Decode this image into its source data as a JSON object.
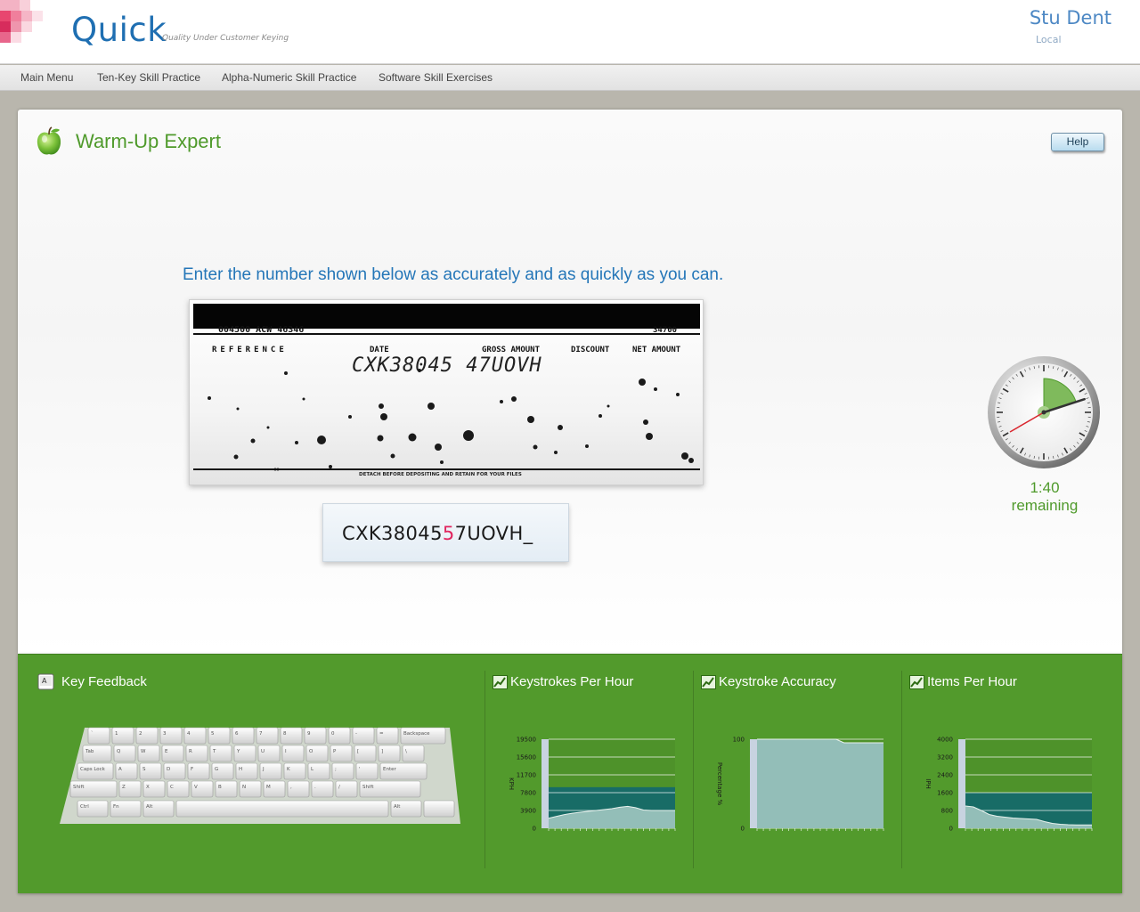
{
  "header": {
    "brand": "Quick",
    "tagline": "Quality Under Customer Keying",
    "user_name": "Stu Dent",
    "user_location": "Local"
  },
  "nav": {
    "items": [
      {
        "label": "Main Menu"
      },
      {
        "label": "Ten-Key Skill Practice"
      },
      {
        "label": "Alpha-Numeric Skill Practice"
      },
      {
        "label": "Software Skill Exercises"
      }
    ]
  },
  "exercise": {
    "title": "Warm-Up Expert",
    "help_label": "Help",
    "instruction": "Enter the number shown below as accurately and as quickly as you can.",
    "document": {
      "account_line": "004500  ACW 46346",
      "amount_corner": "34700",
      "columns": [
        "REFERENCE",
        "DATE",
        "GROSS AMOUNT",
        "DISCOUNT",
        "NET AMOUNT"
      ],
      "handwritten_value": "CXK38045 47UOVH",
      "footer_text": "DETACH BEFORE DEPOSITING AND RETAIN FOR YOUR FILES"
    },
    "entry": {
      "before_error": "CXK38045",
      "error_char": "5",
      "after_error": "7UOVH_"
    },
    "timer": {
      "remaining_label": "1:40 remaining",
      "elapsed_fraction": 0.2
    }
  },
  "stats": {
    "key_feedback": {
      "title": "Key Feedback"
    },
    "keyboard_keys": {
      "backspace": "Backspace",
      "tab": "Tab",
      "caps": "Caps Lock",
      "shift_left": "Shift",
      "shift_right": "Shift",
      "enter": "Enter",
      "ctrl": "Ctrl",
      "fn": "Fn",
      "alt_left": "Alt",
      "alt_right": "Alt",
      "row_top": [
        "`",
        "1",
        "2",
        "3",
        "4",
        "5",
        "6",
        "7",
        "8",
        "9",
        "0",
        "-",
        "="
      ],
      "row_q": [
        "Q",
        "W",
        "E",
        "R",
        "T",
        "Y",
        "U",
        "I",
        "O",
        "P",
        "[",
        "]",
        "\\"
      ],
      "row_a": [
        "A",
        "S",
        "D",
        "F",
        "G",
        "H",
        "J",
        "K",
        "L",
        ";",
        "'"
      ],
      "row_z": [
        "Z",
        "X",
        "C",
        "V",
        "B",
        "N",
        "M",
        ",",
        ".",
        "/"
      ]
    },
    "charts": [
      {
        "title": "Keystrokes Per Hour",
        "chart_data": {
          "type": "area",
          "ylabel": "KPH",
          "y_ticks": [
            "19500",
            "15600",
            "11700",
            "7800",
            "3900",
            "0"
          ],
          "ylim": [
            0,
            19500
          ],
          "values": [
            2200,
            2600,
            3000,
            3300,
            3500,
            3700,
            3900,
            4100,
            4300,
            4600,
            4800,
            4500,
            4000,
            3900,
            3900,
            3900,
            3900
          ],
          "band": [
            0,
            9000
          ]
        }
      },
      {
        "title": "Keystroke Accuracy",
        "chart_data": {
          "type": "area",
          "ylabel": "Percentage %",
          "y_ticks": [
            "100",
            "0"
          ],
          "ylim": [
            0,
            100
          ],
          "values": [
            100,
            100,
            100,
            100,
            100,
            100,
            100,
            100,
            100,
            100,
            100,
            96,
            96,
            96,
            96,
            96,
            96
          ],
          "band": [
            0,
            0
          ]
        }
      },
      {
        "title": "Items Per Hour",
        "chart_data": {
          "type": "area",
          "ylabel": "IPH",
          "y_ticks": [
            "4000",
            "3200",
            "2400",
            "1600",
            "800",
            "0"
          ],
          "ylim": [
            0,
            4000
          ],
          "values": [
            1000,
            960,
            800,
            620,
            540,
            500,
            460,
            440,
            420,
            400,
            300,
            220,
            180,
            160,
            150,
            150,
            150
          ],
          "band": [
            0,
            1600
          ]
        }
      }
    ]
  }
}
